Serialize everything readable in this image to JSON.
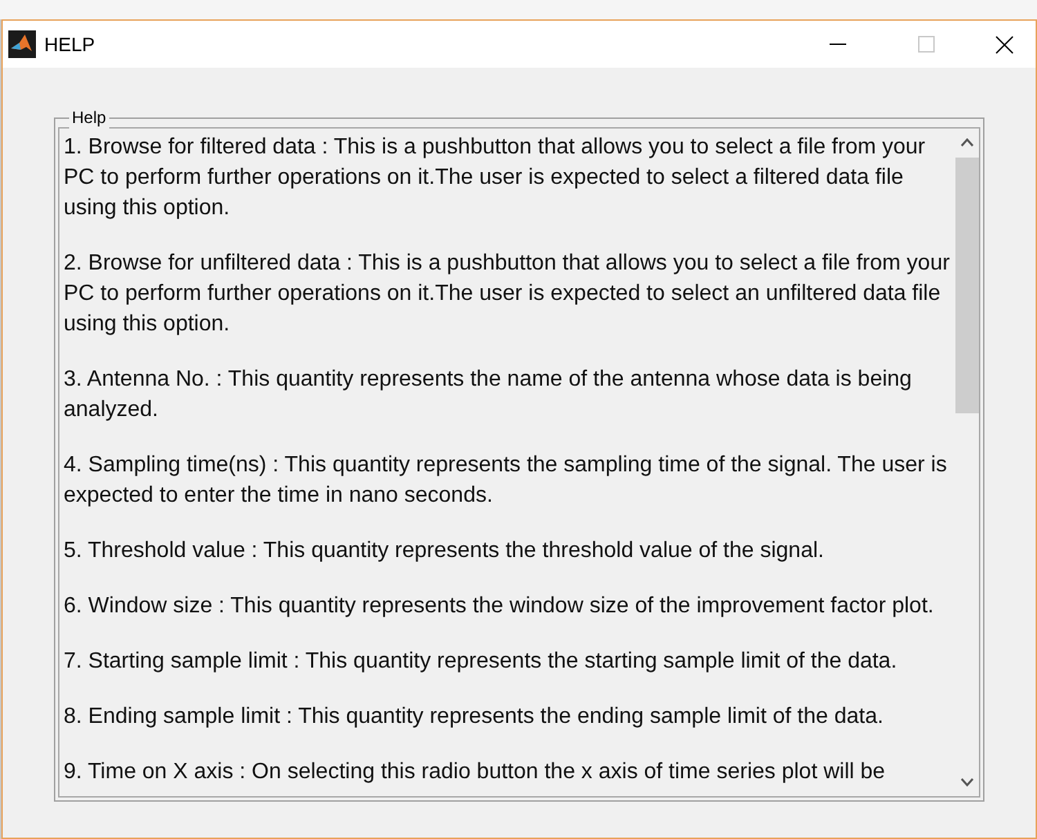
{
  "window": {
    "title": "HELP",
    "maximize_disabled": true
  },
  "group": {
    "label": "Help"
  },
  "items": [
    "1. Browse for filtered data : This is a pushbutton that allows you to select a file from your PC to perform further operations on it.The user is expected to select a filtered data file using this option.",
    "2. Browse for unfiltered data : This is a pushbutton that allows you to select a file from your PC to perform further operations on it.The user is expected to select an unfiltered data file using this option.",
    "3. Antenna No. : This quantity represents the name of the antenna whose data is being analyzed.",
    "4. Sampling time(ns) : This quantity represents the sampling time of the signal. The user is expected to enter the time in nano seconds.",
    "5. Threshold value : This quantity represents the threshold value of the signal.",
    "6. Window size : This quantity represents the window size of the improvement factor plot.",
    "7. Starting sample limit :  This quantity represents the starting sample limit of the data.",
    "8. Ending sample limit :  This quantity represents the ending sample limit of the data.",
    "9. Time on X axis : On selecting this radio button the x axis of time series plot will be"
  ]
}
